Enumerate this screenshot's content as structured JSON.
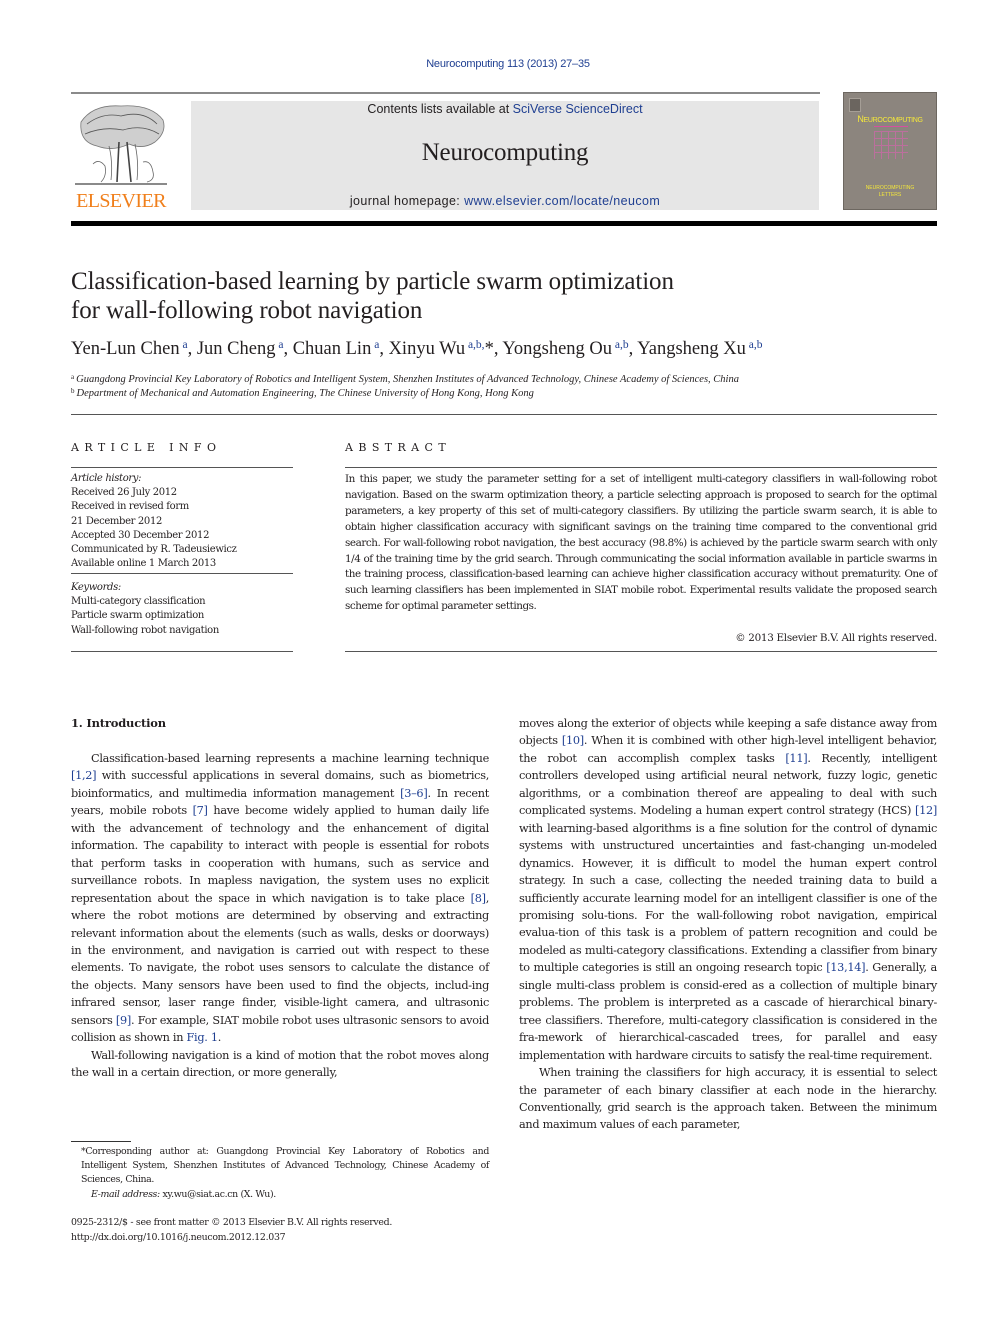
{
  "header": {
    "journal_ref": "Neurocomputing 113 (2013) 27–35",
    "contents_prefix": "Contents lists available at ",
    "contents_link": "SciVerse ScienceDirect",
    "journal_name": "Neurocomputing",
    "homepage_prefix": "journal homepage: ",
    "homepage_link": "www.elsevier.com/locate/neucom",
    "publisher_logo_text": "ELSEVIER",
    "cover": {
      "title_first": "N",
      "title_rest": "EUROCOMPUTING",
      "subtitle_line1": "NEUROCOMPUTING",
      "subtitle_line2": "LETTERS"
    },
    "colors": {
      "link": "#1f3f91",
      "publisher_orange": "#f07f1b",
      "banner_gray": "#e6e6e6",
      "cover_bg": "#8c857e",
      "cover_title": "#f5e83a"
    }
  },
  "article": {
    "title_line1": "Classification-based learning by particle swarm optimization",
    "title_line2": "for wall-following robot navigation",
    "authors": [
      {
        "name": "Yen-Lun Chen",
        "sup": "a",
        "sep": ", "
      },
      {
        "name": "Jun Cheng",
        "sup": "a",
        "sep": ", "
      },
      {
        "name": "Chuan Lin",
        "sup": "a",
        "sep": ", "
      },
      {
        "name": "Xinyu Wu",
        "sup": "a,b,",
        "mark": "*",
        "sep": ", "
      },
      {
        "name": "Yongsheng Ou",
        "sup": "a,b",
        "sep": ", "
      },
      {
        "name": "Yangsheng Xu",
        "sup": "a,b",
        "sep": ""
      }
    ],
    "affiliations": [
      {
        "label": "a",
        "text": "Guangdong Provincial Key Laboratory of Robotics and Intelligent System, Shenzhen Institutes of Advanced Technology, Chinese Academy of Sciences, China"
      },
      {
        "label": "b",
        "text": "Department of Mechanical and Automation Engineering, The Chinese University of Hong Kong, Hong Kong"
      }
    ]
  },
  "article_info": {
    "heading": "ARTICLE INFO",
    "history_label": "Article history:",
    "history": [
      "Received 26 July 2012",
      "Received in revised form",
      "21 December 2012",
      "Accepted 30 December 2012",
      "Communicated by R. Tadeusiewicz",
      "Available online 1 March 2013"
    ],
    "keywords_label": "Keywords:",
    "keywords": [
      "Multi-category classification",
      "Particle swarm optimization",
      "Wall-following robot navigation"
    ]
  },
  "abstract": {
    "heading": "ABSTRACT",
    "text": "In this paper, we study the parameter setting for a set of intelligent multi-category classifiers in wall-following robot navigation. Based on the swarm optimization theory, a particle selecting approach is proposed to search for the optimal parameters, a key property of this set of multi-category classifiers. By utilizing the particle swarm search, it is able to obtain higher classification accuracy with significant savings on the training time compared to the conventional grid search. For wall-following robot navigation, the best accuracy (98.8%) is achieved by the particle swarm search with only 1/4 of the training time by the grid search. Through communicating the social information available in particle swarms in the training process, classification-based learning can achieve higher classification accuracy without prematurity. One of such learning classifiers has been implemented in SIAT mobile robot. Experimental results validate the proposed search scheme for optimal parameter settings.",
    "copyright": "© 2013 Elsevier B.V. All rights reserved."
  },
  "introduction": {
    "heading": "1.   Introduction",
    "left_p1": [
      {
        "t": "Classification-based learning represents a machine learning technique "
      },
      {
        "t": "[1,2]",
        "link": true
      },
      {
        "t": " with successful applications in several domains, such as biometrics, bioinformatics, and multimedia information management "
      },
      {
        "t": "[3–6]",
        "link": true
      },
      {
        "t": ". In recent years, mobile robots "
      },
      {
        "t": "[7]",
        "link": true
      },
      {
        "t": " have become widely applied to human daily life with the advancement of technology and the enhancement of digital information. The capability to interact with people is essential for robots that perform tasks in cooperation with humans, such as service and surveillance robots. In mapless navigation, the system uses no explicit representation about the space in which navigation is to take place "
      },
      {
        "t": "[8]",
        "link": true
      },
      {
        "t": ", where the robot motions are determined by observing and extracting relevant information about the elements (such as walls, desks or doorways) in the environment, and navigation is carried out with respect to these elements. To navigate, the robot uses sensors to calculate the distance of the objects. Many sensors have been used to find the objects, includ-ing infrared sensor, laser range finder, visible-light camera, and ultrasonic sensors "
      },
      {
        "t": "[9]",
        "link": true
      },
      {
        "t": ". For example, SIAT mobile robot uses ultrasonic sensors to avoid collision as shown in "
      },
      {
        "t": "Fig. 1",
        "link": true
      },
      {
        "t": "."
      }
    ],
    "left_p2": [
      {
        "t": "Wall-following navigation is a kind of motion that the robot moves along the wall in a certain direction, or more generally,"
      }
    ],
    "right_p1": [
      {
        "t": "moves along the exterior of objects while keeping a safe distance away from objects "
      },
      {
        "t": "[10]",
        "link": true
      },
      {
        "t": ". When it is combined with other high-level intelligent behavior, the robot can accomplish complex tasks "
      },
      {
        "t": "[11]",
        "link": true
      },
      {
        "t": ". Recently, intelligent controllers developed using artificial neural network, fuzzy logic, genetic algorithms, or a combination thereof are appealing to deal with such complicated systems. Modeling a human expert control strategy (HCS) "
      },
      {
        "t": "[12]",
        "link": true
      },
      {
        "t": " with learning-based algorithms is a fine solution for the control of dynamic systems with unstructured uncertainties and fast-changing un-modeled dynamics. However, it is difficult to model the human expert control strategy. In such a case, collecting the needed training data to build a sufficiently accurate learning model for an intelligent classifier is one of the promising solu-tions. For the wall-following robot navigation, empirical evalua-tion of this task is a problem of pattern recognition and could be modeled as multi-category classifications. Extending a classifier from binary to multiple categories is still an ongoing research topic "
      },
      {
        "t": "[13,14]",
        "link": true
      },
      {
        "t": ". Generally, a single multi-class problem is consid-ered as a collection of multiple binary problems. The problem is interpreted as a cascade of hierarchical binary-tree classifiers. Therefore, multi-category classification is considered in the fra-mework of hierarchical-cascaded trees, for parallel and easy implementation with hardware circuits to satisfy the real-time requirement."
      }
    ],
    "right_p2": [
      {
        "t": "When training the classifiers for high accuracy, it is essential to select the parameter of each binary classifier at each node in the hierarchy. Conventionally, grid search is the approach taken. Between the minimum and maximum values of each parameter,"
      }
    ]
  },
  "footnote": {
    "mark": "*",
    "corresponding": "Corresponding author at: Guangdong Provincial Key Laboratory of Robotics and Intelligent System, Shenzhen Institutes of Advanced Technology, Chinese Academy of Sciences, China.",
    "email_label": "E-mail address: ",
    "email": "xy.wu@siat.ac.cn",
    "email_suffix": " (X. Wu)."
  },
  "front_matter": {
    "issn_line": "0925-2312/$ - see front matter © 2013 Elsevier B.V. All rights reserved.",
    "doi": "http://dx.doi.org/10.1016/j.neucom.2012.12.037"
  }
}
